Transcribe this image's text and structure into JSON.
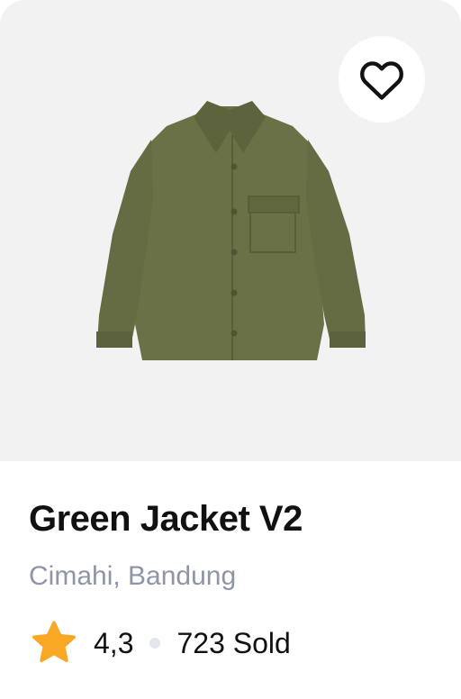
{
  "product": {
    "title": "Green Jacket V2",
    "location": "Cimahi, Bandung",
    "rating": "4,3",
    "sold": "723 Sold",
    "image_alt": "green-jacket-image"
  },
  "icons": {
    "favorite": "heart-outline-icon",
    "rating": "star-icon"
  },
  "colors": {
    "image_background": "#f2f2f2",
    "jacket": "#6b7147",
    "star": "#f9a825",
    "title": "#111111",
    "subtitle": "#8d95a6",
    "separator_dot": "#e3e6ec"
  }
}
